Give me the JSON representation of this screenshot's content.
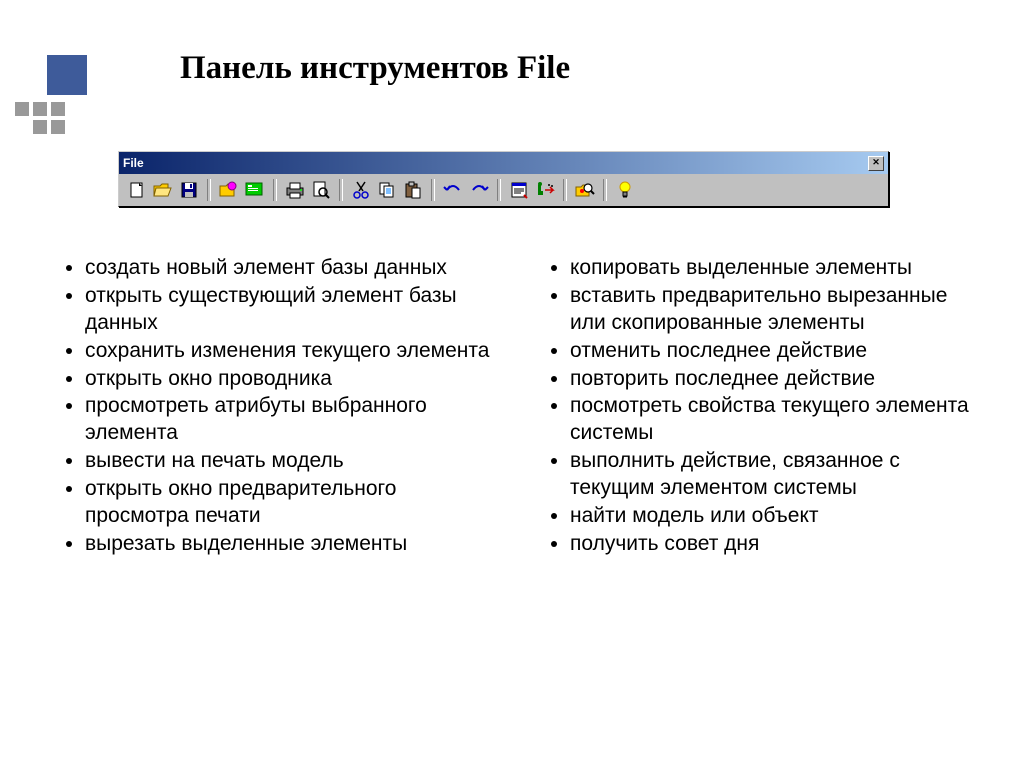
{
  "title": "Панель инструментов File",
  "toolbar": {
    "title": "File",
    "close": "✕"
  },
  "left_items": [
    "создать новый элемент базы данных",
    "открыть существующий элемент базы данных",
    "сохранить изменения текущего элемента",
    "открыть окно проводника",
    "просмотреть атрибуты выбранного элемента",
    "вывести на печать модель",
    "открыть окно предварительного просмотра печати",
    "вырезать выделенные элементы"
  ],
  "right_items": [
    "копировать выделенные элементы",
    "вставить предварительно вырезанные или скопированные элементы",
    "отменить последнее действие",
    "повторить последнее действие",
    "посмотреть свойства текущего элемента системы",
    "выполнить действие, связанное с текущим элементом системы",
    "найти модель или объект",
    "получить совет дня"
  ]
}
